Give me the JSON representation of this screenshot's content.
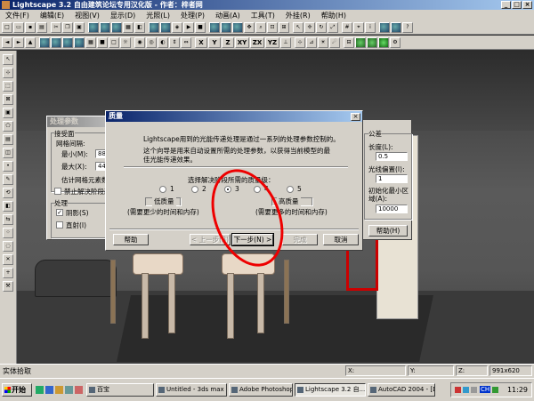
{
  "app": {
    "title": "Lightscape 3.2 自由建筑论坛专用汉化版 - 作者：梓者网",
    "window_buttons": [
      "_",
      "□",
      "×"
    ]
  },
  "menu": [
    "文件(F)",
    "编辑(E)",
    "视图(V)",
    "显示(D)",
    "光照(L)",
    "处理(P)",
    "动画(A)",
    "工具(T)",
    "外挂(R)",
    "帮助(H)"
  ],
  "toolbar2_labels": [
    "X",
    "Y",
    "Z",
    "XY",
    "ZX",
    "YZ"
  ],
  "status": {
    "text": "实体拾取",
    "x_label": "X:",
    "y_label": "Y:",
    "z_label": "Z:",
    "resolution": "991x620"
  },
  "taskbar": {
    "start": "开始",
    "buttons": [
      "百宝",
      "Untitled - 3ds max ...",
      "Adobe Photoshop",
      "Lightscape 3.2 自...",
      "AutoCAD 2004 - [D..."
    ],
    "tray_badge": "CH",
    "clock": "11:29"
  },
  "proc_dialog": {
    "title": "处理参数",
    "group_surface": "接受面",
    "mesh_spacing": "网格间隔:",
    "min_label": "最小(M):",
    "min_value": "88",
    "max_label": "最大(X):",
    "max_value": "440",
    "estimate_label": "估计网格元素数",
    "disable_label": "禁止解决阶段改",
    "group_process": "处理",
    "shadow_label": "阴影(S)",
    "direct_label": "直射(I)"
  },
  "right_panel": {
    "title": "公差",
    "length_label": "长度(L):",
    "length_value": "0.5",
    "offset_label": "光线偏置(I):",
    "offset_value": "1",
    "init_label": "初始化最小区域(A):",
    "init_value": "10000",
    "help_button": "帮助(H)"
  },
  "quality_dialog": {
    "title": "质量",
    "intro": "Lightscape用到的光能传递处理是通过一系列的处理参数控制的。",
    "para": "这个向导是用来自动设置所需的处理参数，以获得当前模型的最佳光能传递效果。",
    "prompt": "选择解决阶段所需的质量级：",
    "options": [
      "1",
      "2",
      "3",
      "4",
      "5"
    ],
    "selected": "3",
    "low_title": "低质量",
    "low_desc": "(需要更少的时间和内存)",
    "high_title": "高质量",
    "high_desc": "(需要更多的时间和内存)",
    "help_button": "帮助",
    "back_button": "< 上一步(B)",
    "next_button": "下一步(N) >",
    "finish_button": "完成",
    "cancel_button": "取消"
  }
}
